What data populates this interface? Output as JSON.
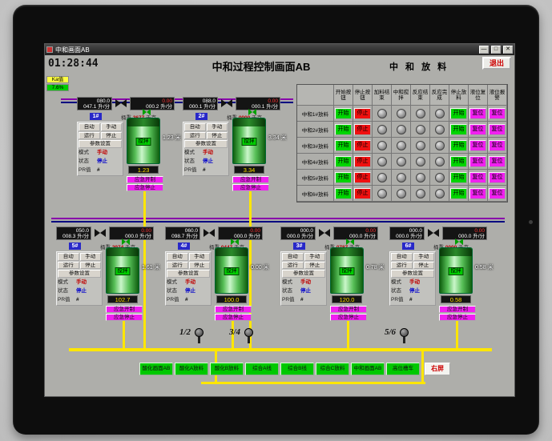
{
  "window": {
    "title": "中和画面AB",
    "btn_min": "—",
    "btn_max": "□",
    "btn_close": "✕"
  },
  "header": {
    "time": "01:28:44",
    "title": "中和过程控制画面AB",
    "right_title": "中 和 放 料",
    "exit_label": "退出",
    "ka_label": "Ka值",
    "ka_value": "7.6%"
  },
  "table": {
    "columns": [
      "开始按钮",
      "停止按钮",
      "加料结束",
      "中和搅拌",
      "反应结束",
      "反应完成",
      "停止放料",
      "液位复位",
      "液位报警"
    ],
    "rows": [
      {
        "label": "中和1#放料"
      },
      {
        "label": "中和2#放料"
      },
      {
        "label": "中和3#放料"
      },
      {
        "label": "中和4#放料"
      },
      {
        "label": "中和5#放料"
      },
      {
        "label": "中和6#放料"
      }
    ],
    "start_label": "开始",
    "stop_label": "停止",
    "reset_label": "复位"
  },
  "unit_labels": {
    "auto": "自动",
    "manual": "手动",
    "run": "运行",
    "stop": "停止",
    "params": "参数设置",
    "mode": "模式",
    "state": "状态",
    "pr": "PR值",
    "stir": "搅拌",
    "emg_open": "应急开制",
    "emg_stop": "应急停止",
    "flow_unit": "升/分",
    "weight_label": "桶重",
    "weight_unit": "千克",
    "level_unit": "米"
  },
  "units": [
    {
      "id": "1#",
      "flow_set": "080.0",
      "flow_act": "047.1",
      "flow2_set": "0.00",
      "flow2_act": "000.2",
      "weight": "3677",
      "mode": "手动",
      "state": "停止",
      "pr": "#",
      "tank_value": "1.23",
      "level": "1.23"
    },
    {
      "id": "2#",
      "flow_set": "088.0",
      "flow_act": "000.1",
      "flow2_set": "0.00",
      "flow2_act": "000.1",
      "weight": "0000",
      "mode": "手动",
      "state": "停止",
      "pr": "#",
      "tank_value": "3.34",
      "level": "3.34"
    },
    {
      "id": "5#",
      "flow_set": "050.0",
      "flow_act": "008.3",
      "flow2_set": "0.00",
      "flow2_act": "000.0",
      "weight": "2974",
      "mode": "手动",
      "state": "停止",
      "pr": "#",
      "tank_value": "102.7",
      "level": "1.61"
    },
    {
      "id": "4#",
      "flow_set": "060.0",
      "flow_act": "098.7",
      "flow2_set": "0.00",
      "flow2_act": "000.0",
      "weight": "0447",
      "mode": "手动",
      "state": "停止",
      "pr": "#",
      "tank_value": "100.0",
      "level": "0.00"
    },
    {
      "id": "3#",
      "flow_set": "000.0",
      "flow_act": "000.0",
      "flow2_set": "0.00",
      "flow2_act": "000.0",
      "weight": "0787",
      "mode": "手动",
      "state": "停止",
      "pr": "#",
      "tank_value": "120.0",
      "level": "0.78"
    },
    {
      "id": "6#",
      "flow_set": "000.0",
      "flow_act": "000.0",
      "flow2_set": "0.00",
      "flow2_act": "000.0",
      "weight": "0000",
      "mode": "手动",
      "state": "停止",
      "pr": "#",
      "tank_value": "0.58",
      "level": "0.58"
    }
  ],
  "pumps": [
    {
      "label": "1/2"
    },
    {
      "label": "3/4"
    },
    {
      "label": "5/6"
    }
  ],
  "nav": {
    "buttons": [
      "酸化画面AB",
      "酸化A放料",
      "酸化B放料",
      "综合A线",
      "综合B线",
      "综合C放料",
      "中和画面AB",
      "高位槽车"
    ],
    "right_screen": "右屏"
  },
  "colors": {
    "pipe_yellow": "#ffe600",
    "line_navy": "#000080",
    "line_purple": "#8800aa",
    "btn_green": "#00c800",
    "btn_red": "#f01010",
    "btn_magenta": "#f020f0"
  }
}
